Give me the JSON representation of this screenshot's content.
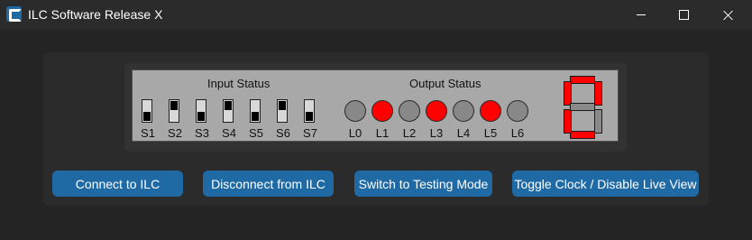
{
  "window": {
    "title": "ILC Software Release X",
    "icons": {
      "logo": "app-logo-icon",
      "minimize": "minimize-icon",
      "maximize": "maximize-icon",
      "close": "close-icon"
    }
  },
  "status_panel": {
    "input_title": "Input Status",
    "output_title": "Output Status",
    "switches": [
      {
        "label": "S1",
        "state": "off"
      },
      {
        "label": "S2",
        "state": "on"
      },
      {
        "label": "S3",
        "state": "off"
      },
      {
        "label": "S4",
        "state": "on"
      },
      {
        "label": "S5",
        "state": "off"
      },
      {
        "label": "S6",
        "state": "on"
      },
      {
        "label": "S7",
        "state": "off"
      }
    ],
    "leds": [
      {
        "label": "L0",
        "on": false
      },
      {
        "label": "L1",
        "on": true
      },
      {
        "label": "L2",
        "on": false
      },
      {
        "label": "L3",
        "on": true
      },
      {
        "label": "L4",
        "on": false
      },
      {
        "label": "L5",
        "on": true
      },
      {
        "label": "L6",
        "on": false
      }
    ],
    "seven_segment": {
      "segments_on": {
        "a": true,
        "b": true,
        "c": false,
        "d": true,
        "e": true,
        "f": true,
        "g": false
      }
    }
  },
  "buttons": {
    "connect": "Connect to ILC",
    "disconnect": "Disconnect from ILC",
    "testing_mode": "Switch to Testing Mode",
    "toggle_clock": "Toggle Clock / Disable Live View"
  },
  "colors": {
    "accent": "#1f6aa5",
    "led_on": "#ff0000",
    "led_off": "#888888",
    "segment_on": "#ff0000",
    "segment_off": "#8a8a8a",
    "panel": "#a8a8a8"
  }
}
